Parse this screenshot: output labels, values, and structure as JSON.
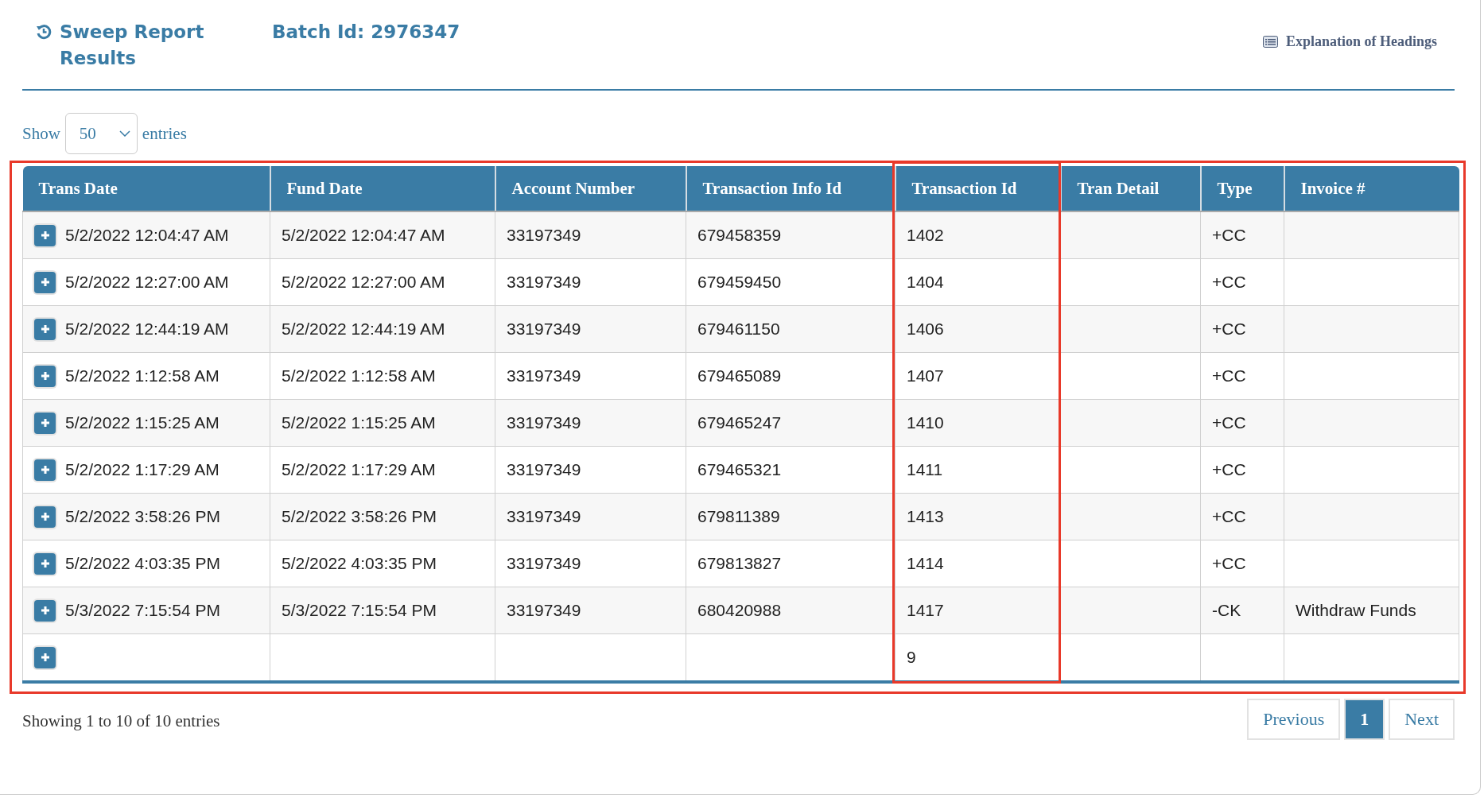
{
  "header": {
    "title": "Sweep Report Results",
    "batch": "Batch Id: 2976347",
    "help_link": "Explanation of Headings"
  },
  "length_menu": {
    "before": "Show",
    "value": "50",
    "after": "entries"
  },
  "table": {
    "highlighted": true,
    "columns": [
      {
        "label": "Trans Date",
        "highlighted": false
      },
      {
        "label": "Fund Date",
        "highlighted": false
      },
      {
        "label": "Account Number",
        "highlighted": false
      },
      {
        "label": "Transaction Info Id",
        "highlighted": false
      },
      {
        "label": "Transaction Id",
        "highlighted": true
      },
      {
        "label": "Tran Detail",
        "highlighted": false
      },
      {
        "label": "Type",
        "highlighted": false
      },
      {
        "label": "Invoice #",
        "highlighted": false
      }
    ],
    "rows": [
      {
        "cells": [
          "5/2/2022 12:04:47 AM",
          "5/2/2022 12:04:47 AM",
          "33197349",
          "679458359",
          "1402",
          null,
          "+CC",
          null
        ]
      },
      {
        "cells": [
          "5/2/2022 12:27:00 AM",
          "5/2/2022 12:27:00 AM",
          "33197349",
          "679459450",
          "1404",
          null,
          "+CC",
          null
        ]
      },
      {
        "cells": [
          "5/2/2022 12:44:19 AM",
          "5/2/2022 12:44:19 AM",
          "33197349",
          "679461150",
          "1406",
          null,
          "+CC",
          null
        ]
      },
      {
        "cells": [
          "5/2/2022 1:12:58 AM",
          "5/2/2022 1:12:58 AM",
          "33197349",
          "679465089",
          "1407",
          null,
          "+CC",
          null
        ]
      },
      {
        "cells": [
          "5/2/2022 1:15:25 AM",
          "5/2/2022 1:15:25 AM",
          "33197349",
          "679465247",
          "1410",
          null,
          "+CC",
          null
        ]
      },
      {
        "cells": [
          "5/2/2022 1:17:29 AM",
          "5/2/2022 1:17:29 AM",
          "33197349",
          "679465321",
          "1411",
          null,
          "+CC",
          null
        ]
      },
      {
        "cells": [
          "5/2/2022 3:58:26 PM",
          "5/2/2022 3:58:26 PM",
          "33197349",
          "679811389",
          "1413",
          null,
          "+CC",
          null
        ]
      },
      {
        "cells": [
          "5/2/2022 4:03:35 PM",
          "5/2/2022 4:03:35 PM",
          "33197349",
          "679813827",
          "1414",
          null,
          "+CC",
          null
        ]
      },
      {
        "cells": [
          "5/3/2022 7:15:54 PM",
          "5/3/2022 7:15:54 PM",
          "33197349",
          "680420988",
          "1417",
          null,
          "-CK",
          "Withdraw Funds"
        ]
      },
      {
        "cells": [
          null,
          null,
          null,
          null,
          "9",
          null,
          null,
          null
        ]
      }
    ]
  },
  "footer": {
    "info": "Showing 1 to 10 of 10 entries",
    "pages": [
      {
        "label": "Previous",
        "selected": false
      },
      {
        "label": "1",
        "selected": true
      },
      {
        "label": "Next",
        "selected": false
      }
    ]
  }
}
